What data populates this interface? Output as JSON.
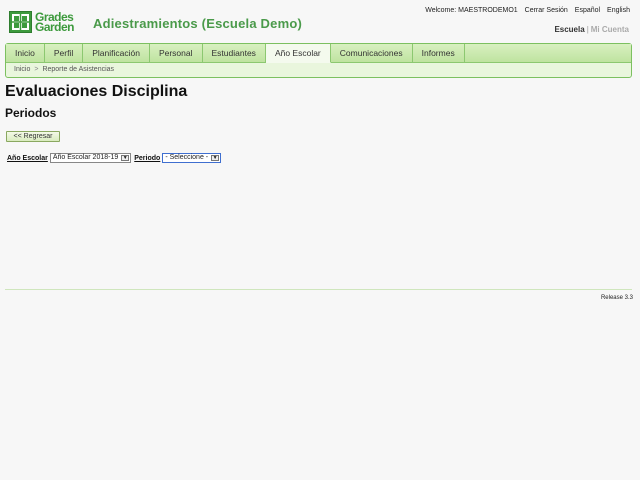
{
  "brand": {
    "logo_line1": "Grades",
    "logo_line2": "Garden",
    "app_title": "Adiestramientos (Escuela Demo)",
    "accent": "#4a9a4a"
  },
  "top_links": {
    "welcome": "Welcome: MAESTRODEMO1",
    "logout": "Cerrar Sesión",
    "spanish": "Español",
    "english": "English"
  },
  "view_switch": {
    "school": "Escuela",
    "separator": "|",
    "account": "Mi Cuenta"
  },
  "nav": {
    "tabs": [
      {
        "label": "Inicio"
      },
      {
        "label": "Perfil"
      },
      {
        "label": "Planificación"
      },
      {
        "label": "Personal"
      },
      {
        "label": "Estudiantes"
      },
      {
        "label": "Año Escolar"
      },
      {
        "label": "Comunicaciones"
      },
      {
        "label": "Informes"
      }
    ],
    "active_tab": "Año Escolar"
  },
  "breadcrumb": {
    "home": "Inicio",
    "separator": ">",
    "current": "Reporte de Asistencias"
  },
  "page": {
    "title": "Evaluaciones Disciplina",
    "subtitle": "Periodos",
    "back_label": "<< Regresar"
  },
  "filters": {
    "year_label": "Año Escolar",
    "year_value": "Año Escolar 2018-19",
    "period_label": "Periodo",
    "period_value": "- Seleccione -"
  },
  "footer": {
    "release": "Release 3.3"
  }
}
